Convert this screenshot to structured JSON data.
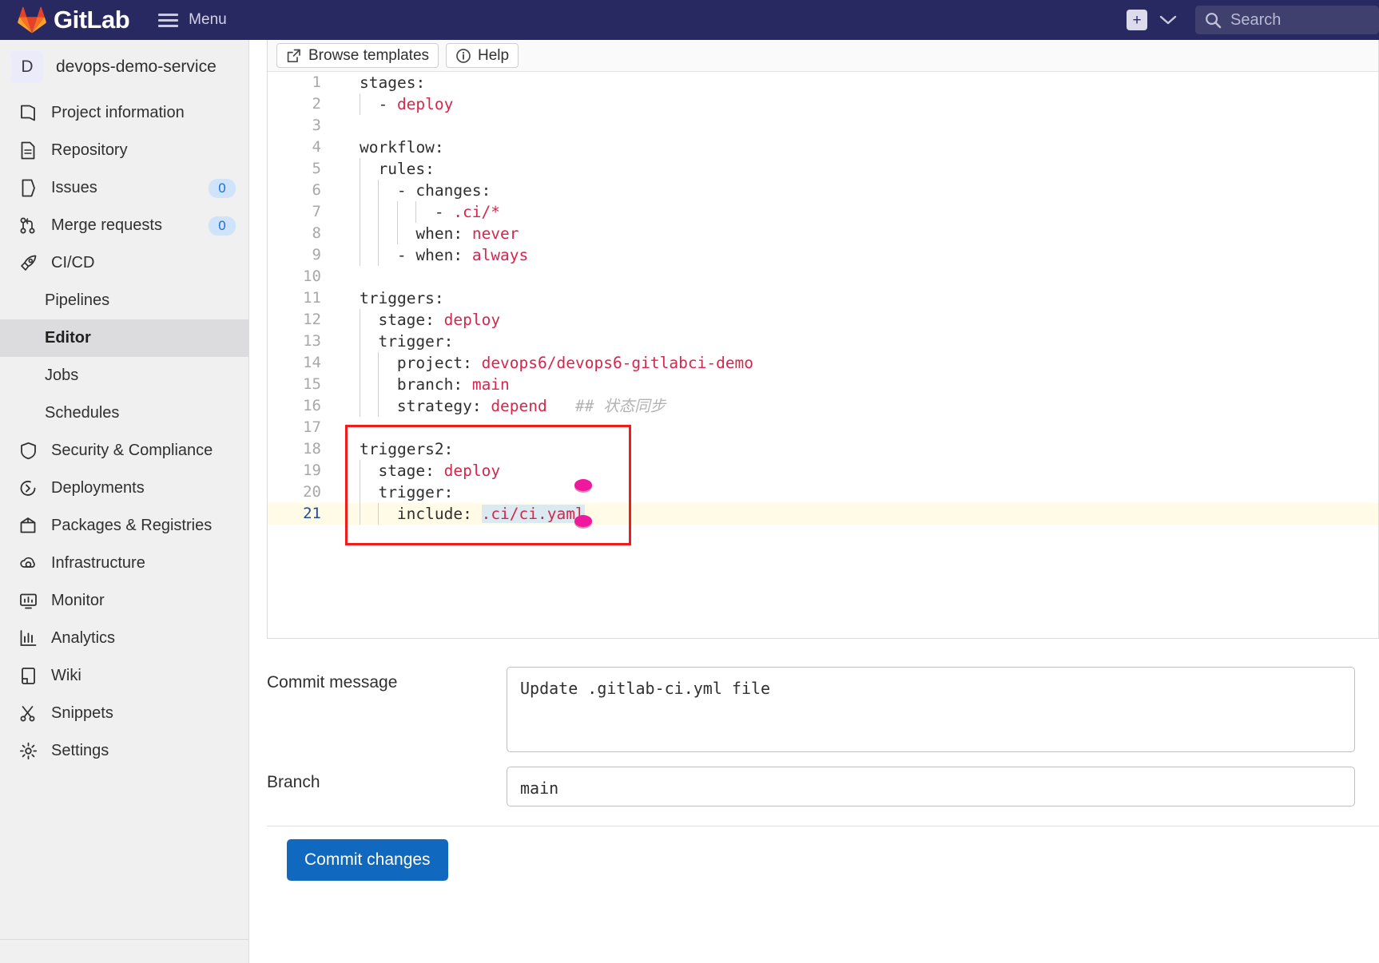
{
  "topbar": {
    "wordmark": "GitLab",
    "menu_label": "Menu",
    "plus_label": "+",
    "search_placeholder": "Search",
    "bg_color": "#292961"
  },
  "sidebar": {
    "project_initial": "D",
    "project_name": "devops-demo-service",
    "items": [
      {
        "label": "Project information",
        "icon": "project-information-icon",
        "badge": null
      },
      {
        "label": "Repository",
        "icon": "repository-icon",
        "badge": null
      },
      {
        "label": "Issues",
        "icon": "issues-icon",
        "badge": "0"
      },
      {
        "label": "Merge requests",
        "icon": "merge-requests-icon",
        "badge": "0"
      },
      {
        "label": "CI/CD",
        "icon": "cicd-rocket-icon",
        "badge": null
      }
    ],
    "cicd_children": [
      {
        "label": "Pipelines",
        "active": false
      },
      {
        "label": "Editor",
        "active": true
      },
      {
        "label": "Jobs",
        "active": false
      },
      {
        "label": "Schedules",
        "active": false
      }
    ],
    "items_after": [
      {
        "label": "Security & Compliance",
        "icon": "shield-icon",
        "badge": null
      },
      {
        "label": "Deployments",
        "icon": "deployments-icon",
        "badge": null
      },
      {
        "label": "Packages & Registries",
        "icon": "package-icon",
        "badge": null
      },
      {
        "label": "Infrastructure",
        "icon": "infrastructure-cloud-icon",
        "badge": null
      },
      {
        "label": "Monitor",
        "icon": "monitor-icon",
        "badge": null
      },
      {
        "label": "Analytics",
        "icon": "analytics-chart-icon",
        "badge": null
      },
      {
        "label": "Wiki",
        "icon": "wiki-book-icon",
        "badge": null
      },
      {
        "label": "Snippets",
        "icon": "snippets-scissors-icon",
        "badge": null
      },
      {
        "label": "Settings",
        "icon": "gear-icon",
        "badge": null
      }
    ]
  },
  "editor": {
    "toolbar": {
      "browse_templates": "Browse templates",
      "help": "Help"
    },
    "file_name": ".gitlab-ci.yml",
    "highlighted_line": 21,
    "selection_text": ".ci/ci.yaml",
    "annotation_color": "#ef1c1c",
    "cursor_marker_color": "#f0189c",
    "lines": [
      {
        "n": 1,
        "indent": 0,
        "guides": 0,
        "segs": [
          {
            "t": "stages:",
            "c": "k"
          }
        ]
      },
      {
        "n": 2,
        "indent": 1,
        "guides": 1,
        "segs": [
          {
            "t": "- ",
            "c": "k"
          },
          {
            "t": "deploy",
            "c": "v"
          }
        ]
      },
      {
        "n": 3,
        "indent": 0,
        "guides": 0,
        "segs": []
      },
      {
        "n": 4,
        "indent": 0,
        "guides": 0,
        "segs": [
          {
            "t": "workflow:",
            "c": "k"
          }
        ]
      },
      {
        "n": 5,
        "indent": 1,
        "guides": 1,
        "segs": [
          {
            "t": "rules:",
            "c": "k"
          }
        ]
      },
      {
        "n": 6,
        "indent": 2,
        "guides": 2,
        "segs": [
          {
            "t": "- changes:",
            "c": "k"
          }
        ]
      },
      {
        "n": 7,
        "indent": 4,
        "guides": 4,
        "segs": [
          {
            "t": "- ",
            "c": "k"
          },
          {
            "t": ".ci/*",
            "c": "v"
          }
        ]
      },
      {
        "n": 8,
        "indent": 3,
        "guides": 3,
        "segs": [
          {
            "t": "when: ",
            "c": "k"
          },
          {
            "t": "never",
            "c": "v"
          }
        ]
      },
      {
        "n": 9,
        "indent": 2,
        "guides": 2,
        "segs": [
          {
            "t": "- when: ",
            "c": "k"
          },
          {
            "t": "always",
            "c": "v"
          }
        ]
      },
      {
        "n": 10,
        "indent": 0,
        "guides": 0,
        "segs": []
      },
      {
        "n": 11,
        "indent": 0,
        "guides": 0,
        "segs": [
          {
            "t": "triggers:",
            "c": "k"
          }
        ]
      },
      {
        "n": 12,
        "indent": 1,
        "guides": 1,
        "segs": [
          {
            "t": "stage: ",
            "c": "k"
          },
          {
            "t": "deploy",
            "c": "v"
          }
        ]
      },
      {
        "n": 13,
        "indent": 1,
        "guides": 1,
        "segs": [
          {
            "t": "trigger:",
            "c": "k"
          }
        ]
      },
      {
        "n": 14,
        "indent": 2,
        "guides": 2,
        "segs": [
          {
            "t": "project: ",
            "c": "k"
          },
          {
            "t": "devops6/devops6-gitlabci-demo",
            "c": "v"
          }
        ]
      },
      {
        "n": 15,
        "indent": 2,
        "guides": 2,
        "segs": [
          {
            "t": "branch: ",
            "c": "k"
          },
          {
            "t": "main",
            "c": "v"
          }
        ]
      },
      {
        "n": 16,
        "indent": 2,
        "guides": 2,
        "segs": [
          {
            "t": "strategy: ",
            "c": "k"
          },
          {
            "t": "depend",
            "c": "v"
          },
          {
            "t": "   ## 状态同步",
            "c": "cm"
          }
        ]
      },
      {
        "n": 17,
        "indent": 0,
        "guides": 0,
        "segs": []
      },
      {
        "n": 18,
        "indent": 0,
        "guides": 0,
        "segs": [
          {
            "t": "triggers2:",
            "c": "k"
          }
        ]
      },
      {
        "n": 19,
        "indent": 1,
        "guides": 1,
        "segs": [
          {
            "t": "stage: ",
            "c": "k"
          },
          {
            "t": "deploy",
            "c": "v"
          }
        ]
      },
      {
        "n": 20,
        "indent": 1,
        "guides": 1,
        "segs": [
          {
            "t": "trigger:",
            "c": "k"
          }
        ]
      },
      {
        "n": 21,
        "indent": 2,
        "guides": 2,
        "hl": true,
        "segs": [
          {
            "t": "include: ",
            "c": "k"
          },
          {
            "t": ".ci/ci.yaml",
            "c": "v sel"
          }
        ]
      }
    ]
  },
  "form": {
    "commit_message_label": "Commit message",
    "commit_message_value": "Update .gitlab-ci.yml file",
    "branch_label": "Branch",
    "branch_value": "main",
    "commit_button_label": "Commit changes",
    "commit_button_color": "#1068bf"
  }
}
